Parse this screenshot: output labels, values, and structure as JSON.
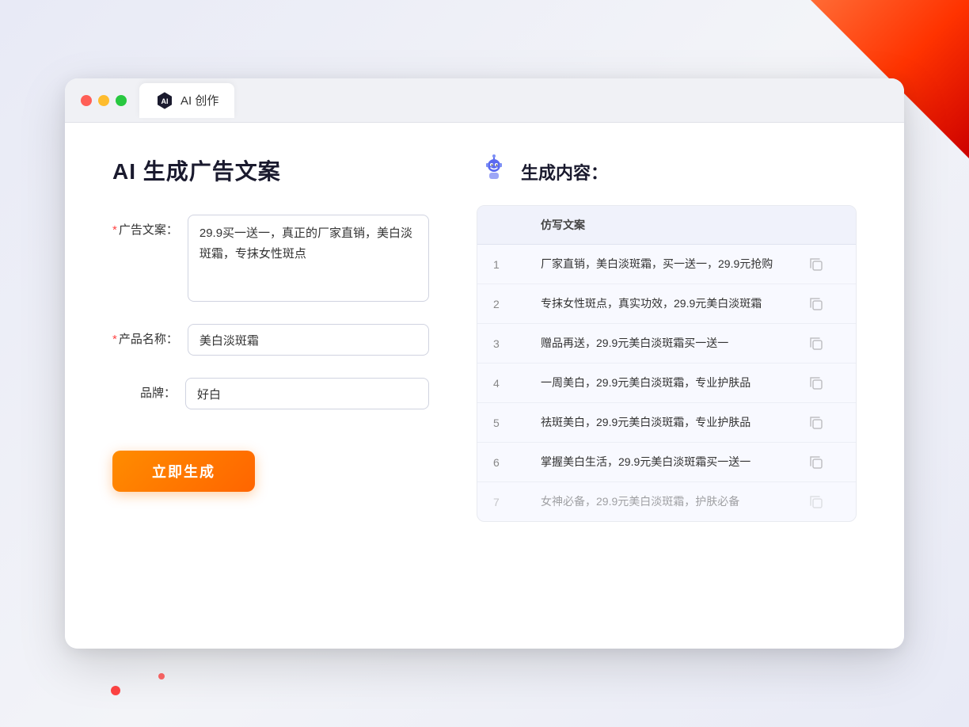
{
  "window": {
    "tab_label": "AI 创作"
  },
  "page": {
    "title": "AI 生成广告文案"
  },
  "form": {
    "ad_copy_label": "广告文案：",
    "ad_copy_required": true,
    "ad_copy_value": "29.9买一送一，真正的厂家直销，美白淡斑霜，专抹女性斑点",
    "product_name_label": "产品名称：",
    "product_name_required": true,
    "product_name_value": "美白淡斑霜",
    "brand_label": "品牌：",
    "brand_required": false,
    "brand_value": "好白",
    "generate_button_label": "立即生成"
  },
  "result": {
    "section_title": "生成内容：",
    "table_header": "仿写文案",
    "items": [
      {
        "num": "1",
        "text": "厂家直销，美白淡斑霜，买一送一，29.9元抢购",
        "faded": false
      },
      {
        "num": "2",
        "text": "专抹女性斑点，真实功效，29.9元美白淡斑霜",
        "faded": false
      },
      {
        "num": "3",
        "text": "赠品再送，29.9元美白淡斑霜买一送一",
        "faded": false
      },
      {
        "num": "4",
        "text": "一周美白，29.9元美白淡斑霜，专业护肤品",
        "faded": false
      },
      {
        "num": "5",
        "text": "祛斑美白，29.9元美白淡斑霜，专业护肤品",
        "faded": false
      },
      {
        "num": "6",
        "text": "掌握美白生活，29.9元美白淡斑霜买一送一",
        "faded": false
      },
      {
        "num": "7",
        "text": "女神必备，29.9元美白淡斑霜，护肤必备",
        "faded": true
      }
    ]
  }
}
